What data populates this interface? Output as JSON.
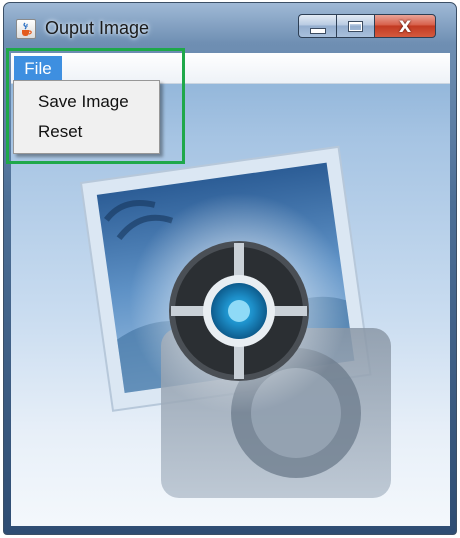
{
  "window": {
    "title": "Ouput Image",
    "close_symbol": "X",
    "icon": "java-cup-icon"
  },
  "menubar": {
    "items": [
      {
        "label": "File",
        "active": true
      }
    ]
  },
  "file_menu": {
    "items": [
      {
        "label": "Save Image"
      },
      {
        "label": "Reset"
      }
    ]
  },
  "colors": {
    "menu_highlight": "#3e8fe0",
    "annotation_box": "#1fa84a",
    "close_button": "#c23a22"
  }
}
